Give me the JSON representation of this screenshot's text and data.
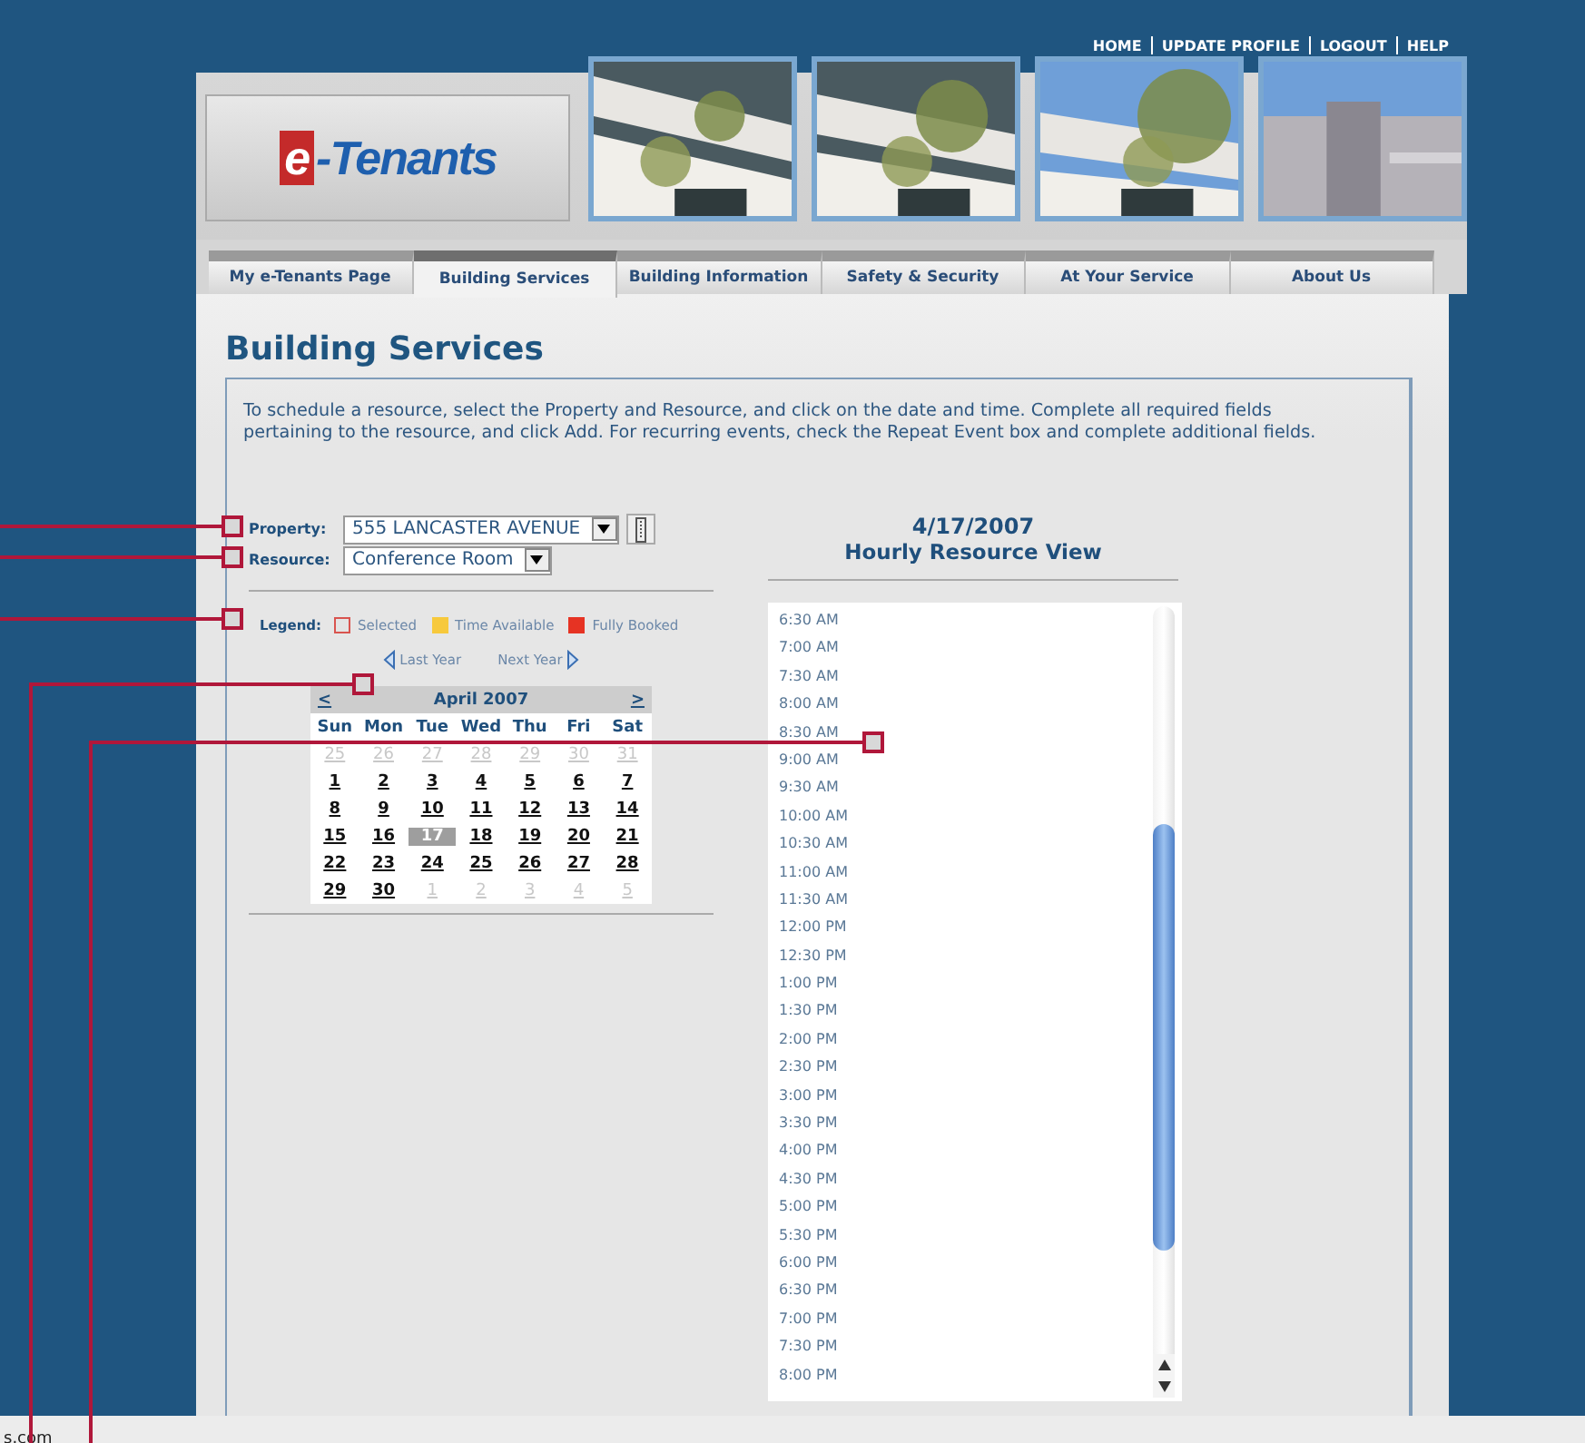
{
  "header": {
    "nav_links": [
      "HOME",
      "UPDATE PROFILE",
      "LOGOUT",
      "HELP"
    ],
    "logo": {
      "mark": "e",
      "text": "-Tenants"
    }
  },
  "tabs": [
    {
      "label": "My e-Tenants Page",
      "selected": false
    },
    {
      "label": "Building Services",
      "selected": true
    },
    {
      "label": "Building Information",
      "selected": false
    },
    {
      "label": "Safety & Security",
      "selected": false
    },
    {
      "label": "At Your Service",
      "selected": false
    },
    {
      "label": "About Us",
      "selected": false
    }
  ],
  "page_title": "Building Services",
  "instructions": "To schedule a resource, select the Property and Resource, and click on the date and time. Complete all required fields pertaining to the resource, and click Add. For recurring events, check the Repeat Event box and complete additional fields.",
  "form": {
    "property": {
      "label": "Property:",
      "value": "555 LANCASTER AVENUE"
    },
    "resource": {
      "label": "Resource:",
      "value": "Conference Room"
    }
  },
  "legend": {
    "label": "Legend:",
    "items": [
      {
        "label": "Selected",
        "kind": "outline",
        "color": "#d9544f"
      },
      {
        "label": "Time Available",
        "kind": "fill",
        "color": "#f7c93c"
      },
      {
        "label": "Fully Booked",
        "kind": "fill",
        "color": "#e63323"
      }
    ]
  },
  "year_nav": {
    "previous": "Last Year",
    "next": "Next Year"
  },
  "calendar": {
    "previous": "<",
    "next": ">",
    "title": "April 2007",
    "weekdays": [
      "Sun",
      "Mon",
      "Tue",
      "Wed",
      "Thu",
      "Fri",
      "Sat"
    ],
    "weeks": [
      [
        {
          "day": "25",
          "kind": "other",
          "selected": false
        },
        {
          "day": "26",
          "kind": "other",
          "selected": false
        },
        {
          "day": "27",
          "kind": "other",
          "selected": false
        },
        {
          "day": "28",
          "kind": "other",
          "selected": false
        },
        {
          "day": "29",
          "kind": "other",
          "selected": false
        },
        {
          "day": "30",
          "kind": "other",
          "selected": false
        },
        {
          "day": "31",
          "kind": "other",
          "selected": false
        }
      ],
      [
        {
          "day": "1",
          "kind": "current",
          "selected": false
        },
        {
          "day": "2",
          "kind": "current",
          "selected": false
        },
        {
          "day": "3",
          "kind": "current",
          "selected": false
        },
        {
          "day": "4",
          "kind": "current",
          "selected": false
        },
        {
          "day": "5",
          "kind": "current",
          "selected": false
        },
        {
          "day": "6",
          "kind": "current",
          "selected": false
        },
        {
          "day": "7",
          "kind": "current",
          "selected": false
        }
      ],
      [
        {
          "day": "8",
          "kind": "current",
          "selected": false
        },
        {
          "day": "9",
          "kind": "current",
          "selected": false
        },
        {
          "day": "10",
          "kind": "current",
          "selected": false
        },
        {
          "day": "11",
          "kind": "current",
          "selected": false
        },
        {
          "day": "12",
          "kind": "current",
          "selected": false
        },
        {
          "day": "13",
          "kind": "current",
          "selected": false
        },
        {
          "day": "14",
          "kind": "current",
          "selected": false
        }
      ],
      [
        {
          "day": "15",
          "kind": "current",
          "selected": false
        },
        {
          "day": "16",
          "kind": "current",
          "selected": false
        },
        {
          "day": "17",
          "kind": "current",
          "selected": true
        },
        {
          "day": "18",
          "kind": "current",
          "selected": false
        },
        {
          "day": "19",
          "kind": "current",
          "selected": false
        },
        {
          "day": "20",
          "kind": "current",
          "selected": false
        },
        {
          "day": "21",
          "kind": "current",
          "selected": false
        }
      ],
      [
        {
          "day": "22",
          "kind": "current",
          "selected": false
        },
        {
          "day": "23",
          "kind": "current",
          "selected": false
        },
        {
          "day": "24",
          "kind": "current",
          "selected": false
        },
        {
          "day": "25",
          "kind": "current",
          "selected": false
        },
        {
          "day": "26",
          "kind": "current",
          "selected": false
        },
        {
          "day": "27",
          "kind": "current",
          "selected": false
        },
        {
          "day": "28",
          "kind": "current",
          "selected": false
        }
      ],
      [
        {
          "day": "29",
          "kind": "current",
          "selected": false
        },
        {
          "day": "30",
          "kind": "current",
          "selected": false
        },
        {
          "day": "1",
          "kind": "other",
          "selected": false
        },
        {
          "day": "2",
          "kind": "other",
          "selected": false
        },
        {
          "day": "3",
          "kind": "other",
          "selected": false
        },
        {
          "day": "4",
          "kind": "other",
          "selected": false
        },
        {
          "day": "5",
          "kind": "other",
          "selected": false
        }
      ]
    ]
  },
  "day_view": {
    "date": "4/17/2007",
    "title": "Hourly Resource View",
    "times": [
      "6:30 AM",
      "7:00 AM",
      "7:30 AM",
      "8:00 AM",
      "8:30 AM",
      "9:00 AM",
      "9:30 AM",
      "10:00 AM",
      "10:30 AM",
      "11:00 AM",
      "11:30 AM",
      "12:00 PM",
      "12:30 PM",
      "1:00 PM",
      "1:30 PM",
      "2:00 PM",
      "2:30 PM",
      "3:00 PM",
      "3:30 PM",
      "4:00 PM",
      "4:30 PM",
      "5:00 PM",
      "5:30 PM",
      "6:00 PM",
      "6:30 PM",
      "7:00 PM",
      "7:30 PM",
      "8:00 PM"
    ]
  },
  "status_bar": {
    "text": "s.com"
  }
}
